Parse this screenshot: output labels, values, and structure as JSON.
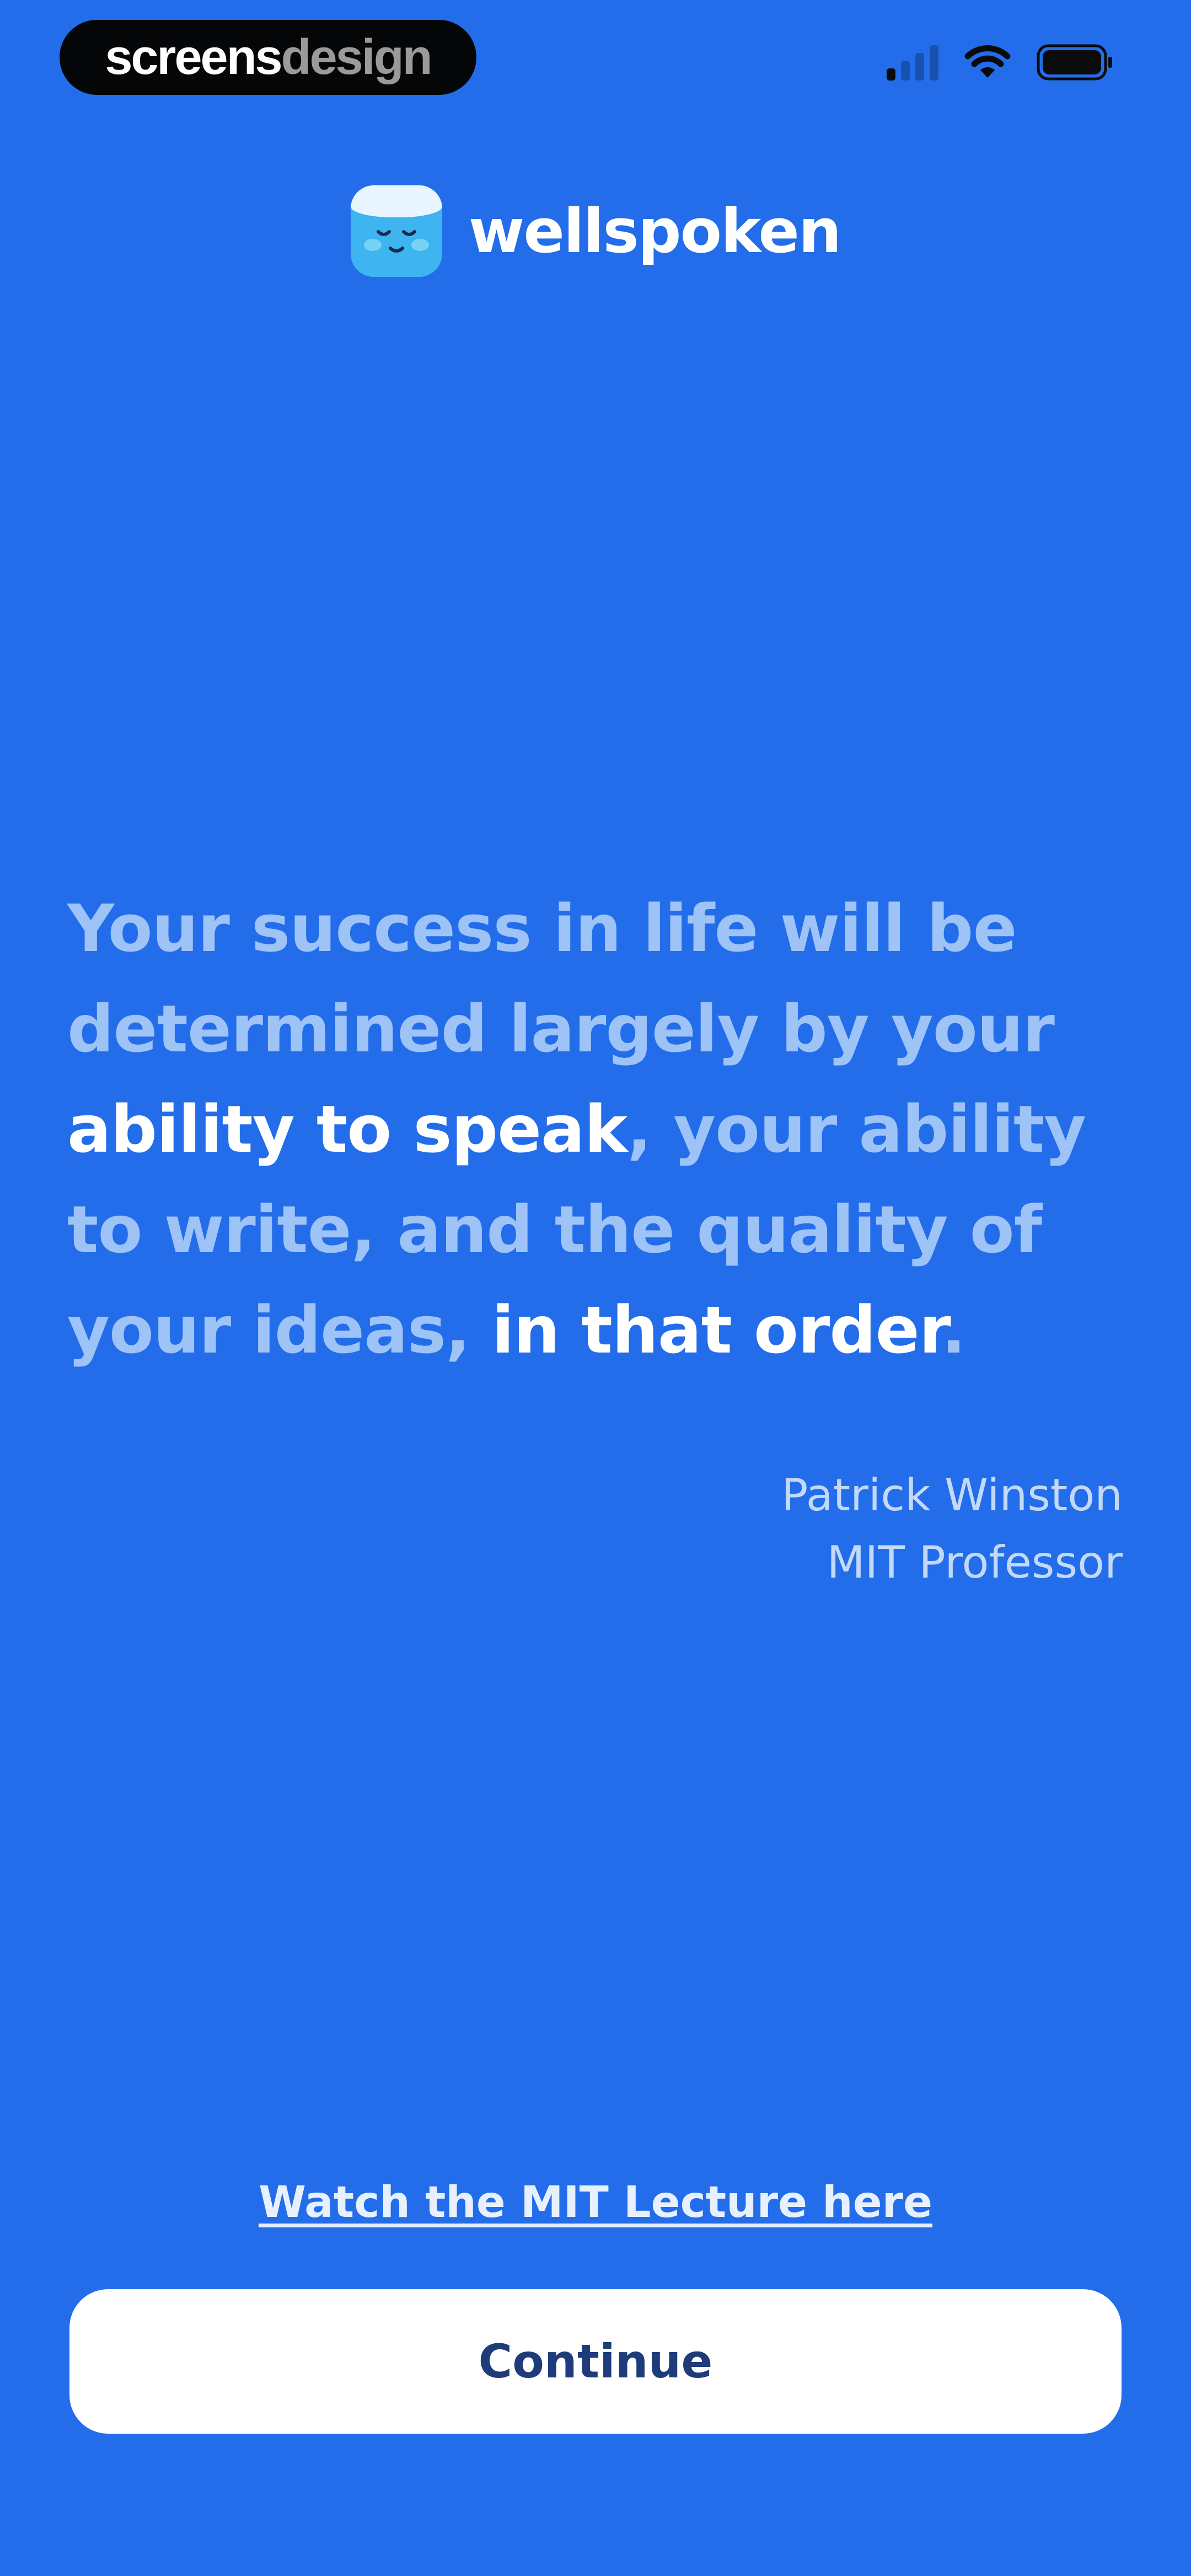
{
  "watermark": {
    "part1": "screens",
    "part2": "design"
  },
  "status_bar": {
    "signal_icon": "cellular-signal-icon",
    "wifi_icon": "wifi-icon",
    "battery_icon": "battery-icon"
  },
  "app": {
    "name": "wellspoken",
    "logo_icon": "sleepy-face-logo-icon",
    "accent_color": "#236DEA"
  },
  "quote": {
    "seg1": "Your success in life will be determined largely by your ",
    "seg2": "ability to speak",
    "seg3": ", your ability to write, and the quality of your ideas, ",
    "seg4": "in that order",
    "seg5": "."
  },
  "attribution": {
    "name": "Patrick Winston",
    "role": "MIT Professor"
  },
  "link": {
    "label": "Watch the MIT Lecture here"
  },
  "continue_button": {
    "label": "Continue"
  }
}
